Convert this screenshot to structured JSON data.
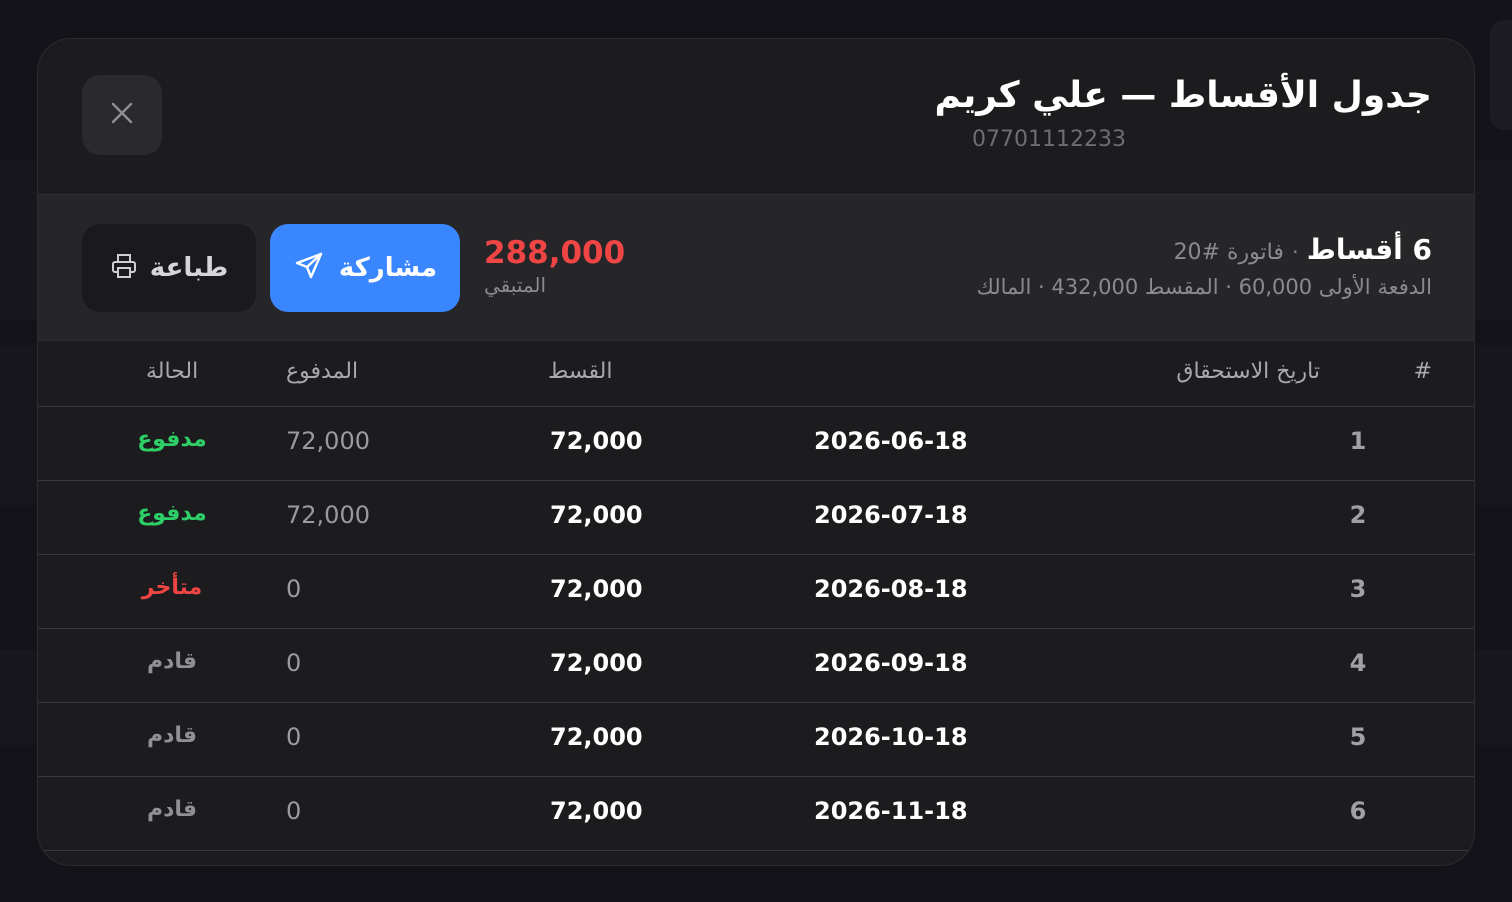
{
  "modal": {
    "title": "جدول الأقساط — علي كريم",
    "phone": "07701112233"
  },
  "summary": {
    "count_label": "6 أقساط",
    "separator": "·",
    "invoice_label": "فاتورة #20",
    "details": "الدفعة الأولى 60,000 · المقسط 432,000 · المالك",
    "remaining_amount": "288,000",
    "remaining_label": "المتبقي"
  },
  "actions": {
    "share_label": "مشاركة",
    "print_label": "طباعة"
  },
  "table": {
    "headers": {
      "num": "#",
      "due_date": "تاريخ الاستحقاق",
      "installment": "القسط",
      "paid": "المدفوع",
      "status": "الحالة"
    },
    "rows": [
      {
        "num": "1",
        "due_date": "2026-06-18",
        "installment": "72,000",
        "paid": "72,000",
        "status": "مدفوع",
        "status_kind": "paid"
      },
      {
        "num": "2",
        "due_date": "2026-07-18",
        "installment": "72,000",
        "paid": "72,000",
        "status": "مدفوع",
        "status_kind": "paid"
      },
      {
        "num": "3",
        "due_date": "2026-08-18",
        "installment": "72,000",
        "paid": "0",
        "status": "متأخر",
        "status_kind": "late"
      },
      {
        "num": "4",
        "due_date": "2026-09-18",
        "installment": "72,000",
        "paid": "0",
        "status": "قادم",
        "status_kind": "upcoming"
      },
      {
        "num": "5",
        "due_date": "2026-10-18",
        "installment": "72,000",
        "paid": "0",
        "status": "قادم",
        "status_kind": "upcoming"
      },
      {
        "num": "6",
        "due_date": "2026-11-18",
        "installment": "72,000",
        "paid": "0",
        "status": "قادم",
        "status_kind": "upcoming"
      }
    ]
  },
  "icons": {
    "close": "close-icon",
    "share": "send-icon",
    "print": "printer-icon"
  },
  "colors": {
    "accent": "#3a86ff",
    "paid": "#2fcf68",
    "late": "#f04545",
    "upcoming": "#8f8f94",
    "remaining": "#f04545"
  }
}
